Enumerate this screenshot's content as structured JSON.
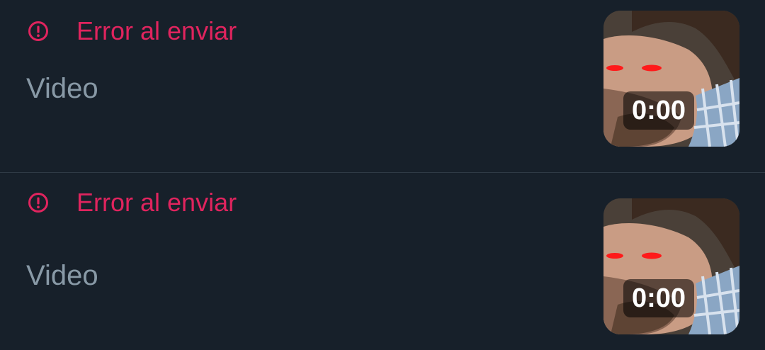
{
  "messages": [
    {
      "status_text": "Error al enviar",
      "status_icon": "error-circle-icon",
      "media_label": "Video",
      "thumbnail_duration": "0:00"
    },
    {
      "status_text": "Error al enviar",
      "status_icon": "error-circle-icon",
      "media_label": "Video",
      "thumbnail_duration": "0:00"
    }
  ],
  "colors": {
    "background": "#17202a",
    "error": "#e0245e",
    "secondary_text": "#8899a6",
    "divider": "#2f3a45"
  }
}
